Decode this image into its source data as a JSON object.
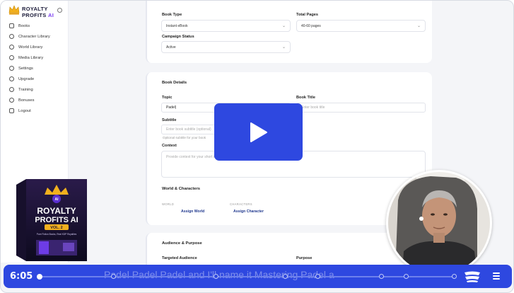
{
  "brand": {
    "line1": "ROYALTY",
    "line2a": "PROFITS ",
    "line2b": "AI"
  },
  "sidebar": {
    "items": [
      {
        "label": "Books",
        "icon": "book-icon"
      },
      {
        "label": "Character Library",
        "icon": "users-icon"
      },
      {
        "label": "World Library",
        "icon": "globe-icon"
      },
      {
        "label": "Media Library",
        "icon": "image-icon"
      },
      {
        "label": "Settings",
        "icon": "gear-icon"
      },
      {
        "label": "Upgrade",
        "icon": "upgrade-icon"
      },
      {
        "label": "Training",
        "icon": "training-icon"
      },
      {
        "label": "Bonuses",
        "icon": "gift-icon"
      },
      {
        "label": "Logout",
        "icon": "logout-icon"
      }
    ]
  },
  "product": {
    "line1": "ROYALTY",
    "line2": "PROFITS AI",
    "vol": "VOL. 2",
    "tagline": "Pure Fiction Books, Real KDP Royalties"
  },
  "form": {
    "book_type_label": "Book Type",
    "book_type_value": "Instant eBook",
    "total_pages_label": "Total Pages",
    "total_pages_value": "40-60 pages",
    "campaign_status_label": "Campaign Status",
    "campaign_status_value": "Active",
    "book_details_title": "Book Details",
    "topic_label": "Topic",
    "topic_value": "Padel|",
    "book_title_label": "Book Title",
    "book_title_placeholder": "Enter book title",
    "subtitle_label": "Subtitle",
    "subtitle_placeholder": "Enter book subtitle (optional)",
    "subtitle_help": "Optional subtitle for your book",
    "context_label": "Context",
    "context_placeholder": "Provide context for your short sto",
    "world_chars_title": "World & Characters",
    "world_mini": "WORLD",
    "characters_mini": "CHARACTERS",
    "assign_world": "Assign World",
    "assign_character": "Assign Character",
    "audience_title": "Audience & Purpose",
    "target_audience_label": "Targeted Audience",
    "purpose_label": "Purpose"
  },
  "player": {
    "time": "6:05",
    "caption": "Padel Padel Padel and I'll name it Mastering Padel a",
    "accent": "#2e48e0"
  }
}
